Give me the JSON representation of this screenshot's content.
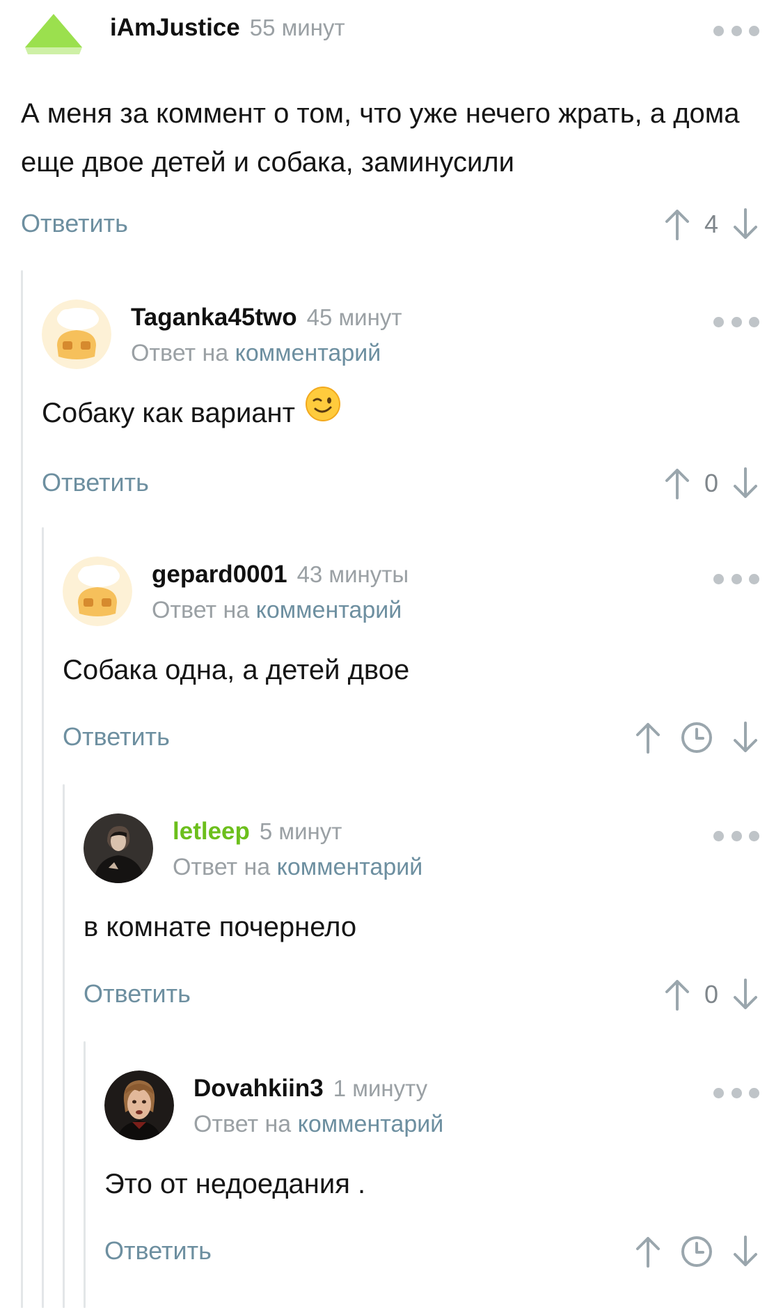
{
  "labels": {
    "reply_button": "Ответить",
    "reply_to_prefix": "Ответ на",
    "reply_to_link": "комментарий"
  },
  "colors": {
    "link": "#6d8fa0",
    "username_highlight": "#6cbf1c",
    "muted": "#9aa0a4"
  },
  "comments": [
    {
      "author": "iAmJustice",
      "time": "55 минут",
      "avatar": "green-triangle-icon",
      "text": "А меня за коммент о том,  что уже нечего жрать,  а дома еще двое детей и собака,  заминусили",
      "score": "4"
    },
    {
      "author": "Taganka45two",
      "time": "45 минут",
      "avatar": "default-chef-avatar",
      "text": "Собаку как вариант",
      "emoji": "winking-face-emoji",
      "score": "0"
    },
    {
      "author": "gepard0001",
      "time": "43 минуты",
      "avatar": "default-chef-avatar",
      "text": "Собака одна, а детей двое",
      "score_hidden": true
    },
    {
      "author": "letleep",
      "time": "5 минут",
      "avatar": "dark-photo-avatar",
      "text": "в комнате почернело",
      "score": "0"
    },
    {
      "author": "Dovahkiin3",
      "time": "1 минуту",
      "avatar": "portrait-photo-avatar",
      "text": "Это от недоедания .",
      "score_hidden": true
    }
  ]
}
